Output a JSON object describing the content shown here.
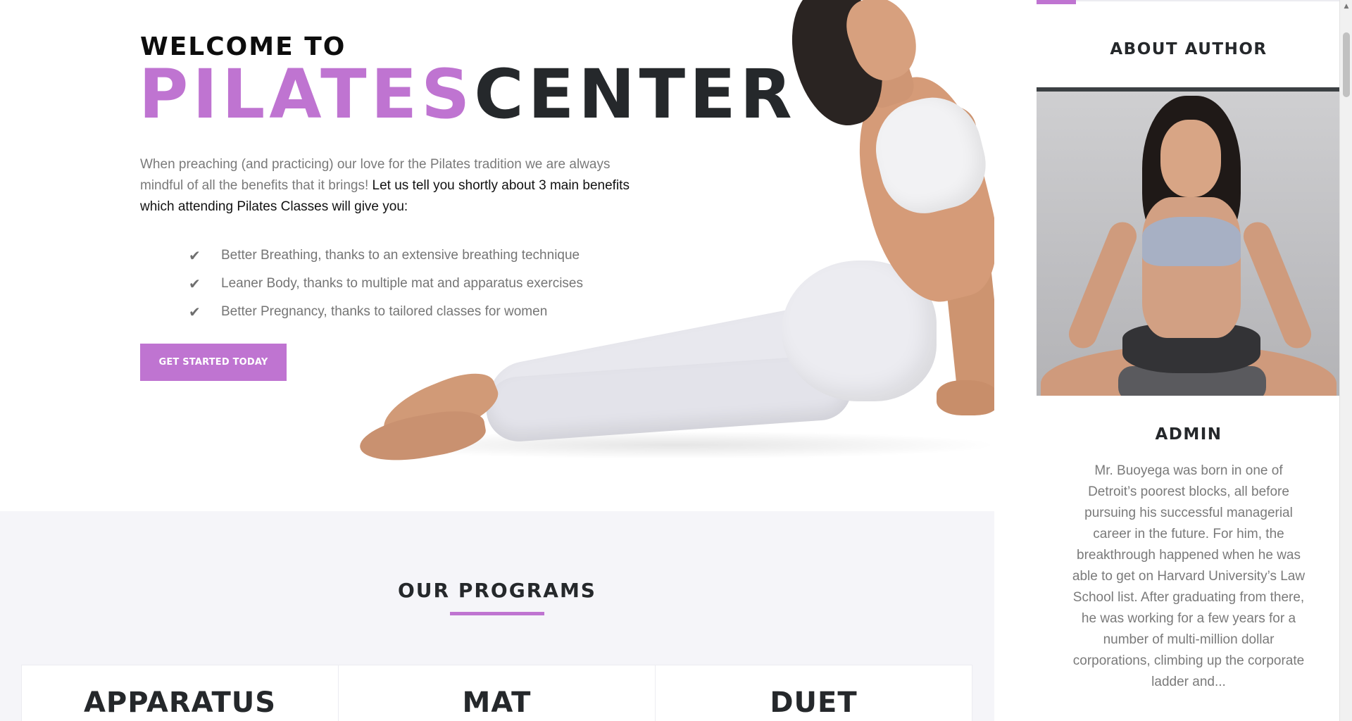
{
  "hero": {
    "welcome": "WELCOME TO",
    "brand_part1": "PILATES",
    "brand_part2": "CENTER",
    "intro_plain": "When preaching (and practicing) our love for the Pilates tradition we are always mindful of all the benefits that it brings! ",
    "intro_bold": "Let us tell you shortly about 3 main benefits which attending Pilates Classes will give you:",
    "benefits": [
      "Better Breathing, thanks to an extensive breathing technique",
      "Leaner Body, thanks to multiple mat and apparatus exercises",
      "Better Pregnancy, thanks to tailored classes for women"
    ],
    "check_icon": "✔",
    "cta_label": "GET STARTED TODAY"
  },
  "programs": {
    "title": "OUR PROGRAMS",
    "cards": [
      "APPARATUS",
      "MAT",
      "DUET"
    ]
  },
  "sidebar": {
    "about_title": "ABOUT AUTHOR",
    "author_name": "ADMIN",
    "author_bio": "Mr. Buoyega was born in one of Detroit’s poorest blocks, all before pursuing his successful managerial career in the future. For him, the breakthrough happened when he was able to get on Harvard University’s Law School list. After graduating from there, he was working for a few years for a number of multi-million dollar corporations, climbing up the corporate ladder and..."
  },
  "scrollbar": {
    "up_arrow": "▲"
  },
  "colors": {
    "accent": "#bf74d1",
    "heading": "#25282b",
    "body_text": "#7a7a7a",
    "programs_bg": "#f5f5f9"
  }
}
